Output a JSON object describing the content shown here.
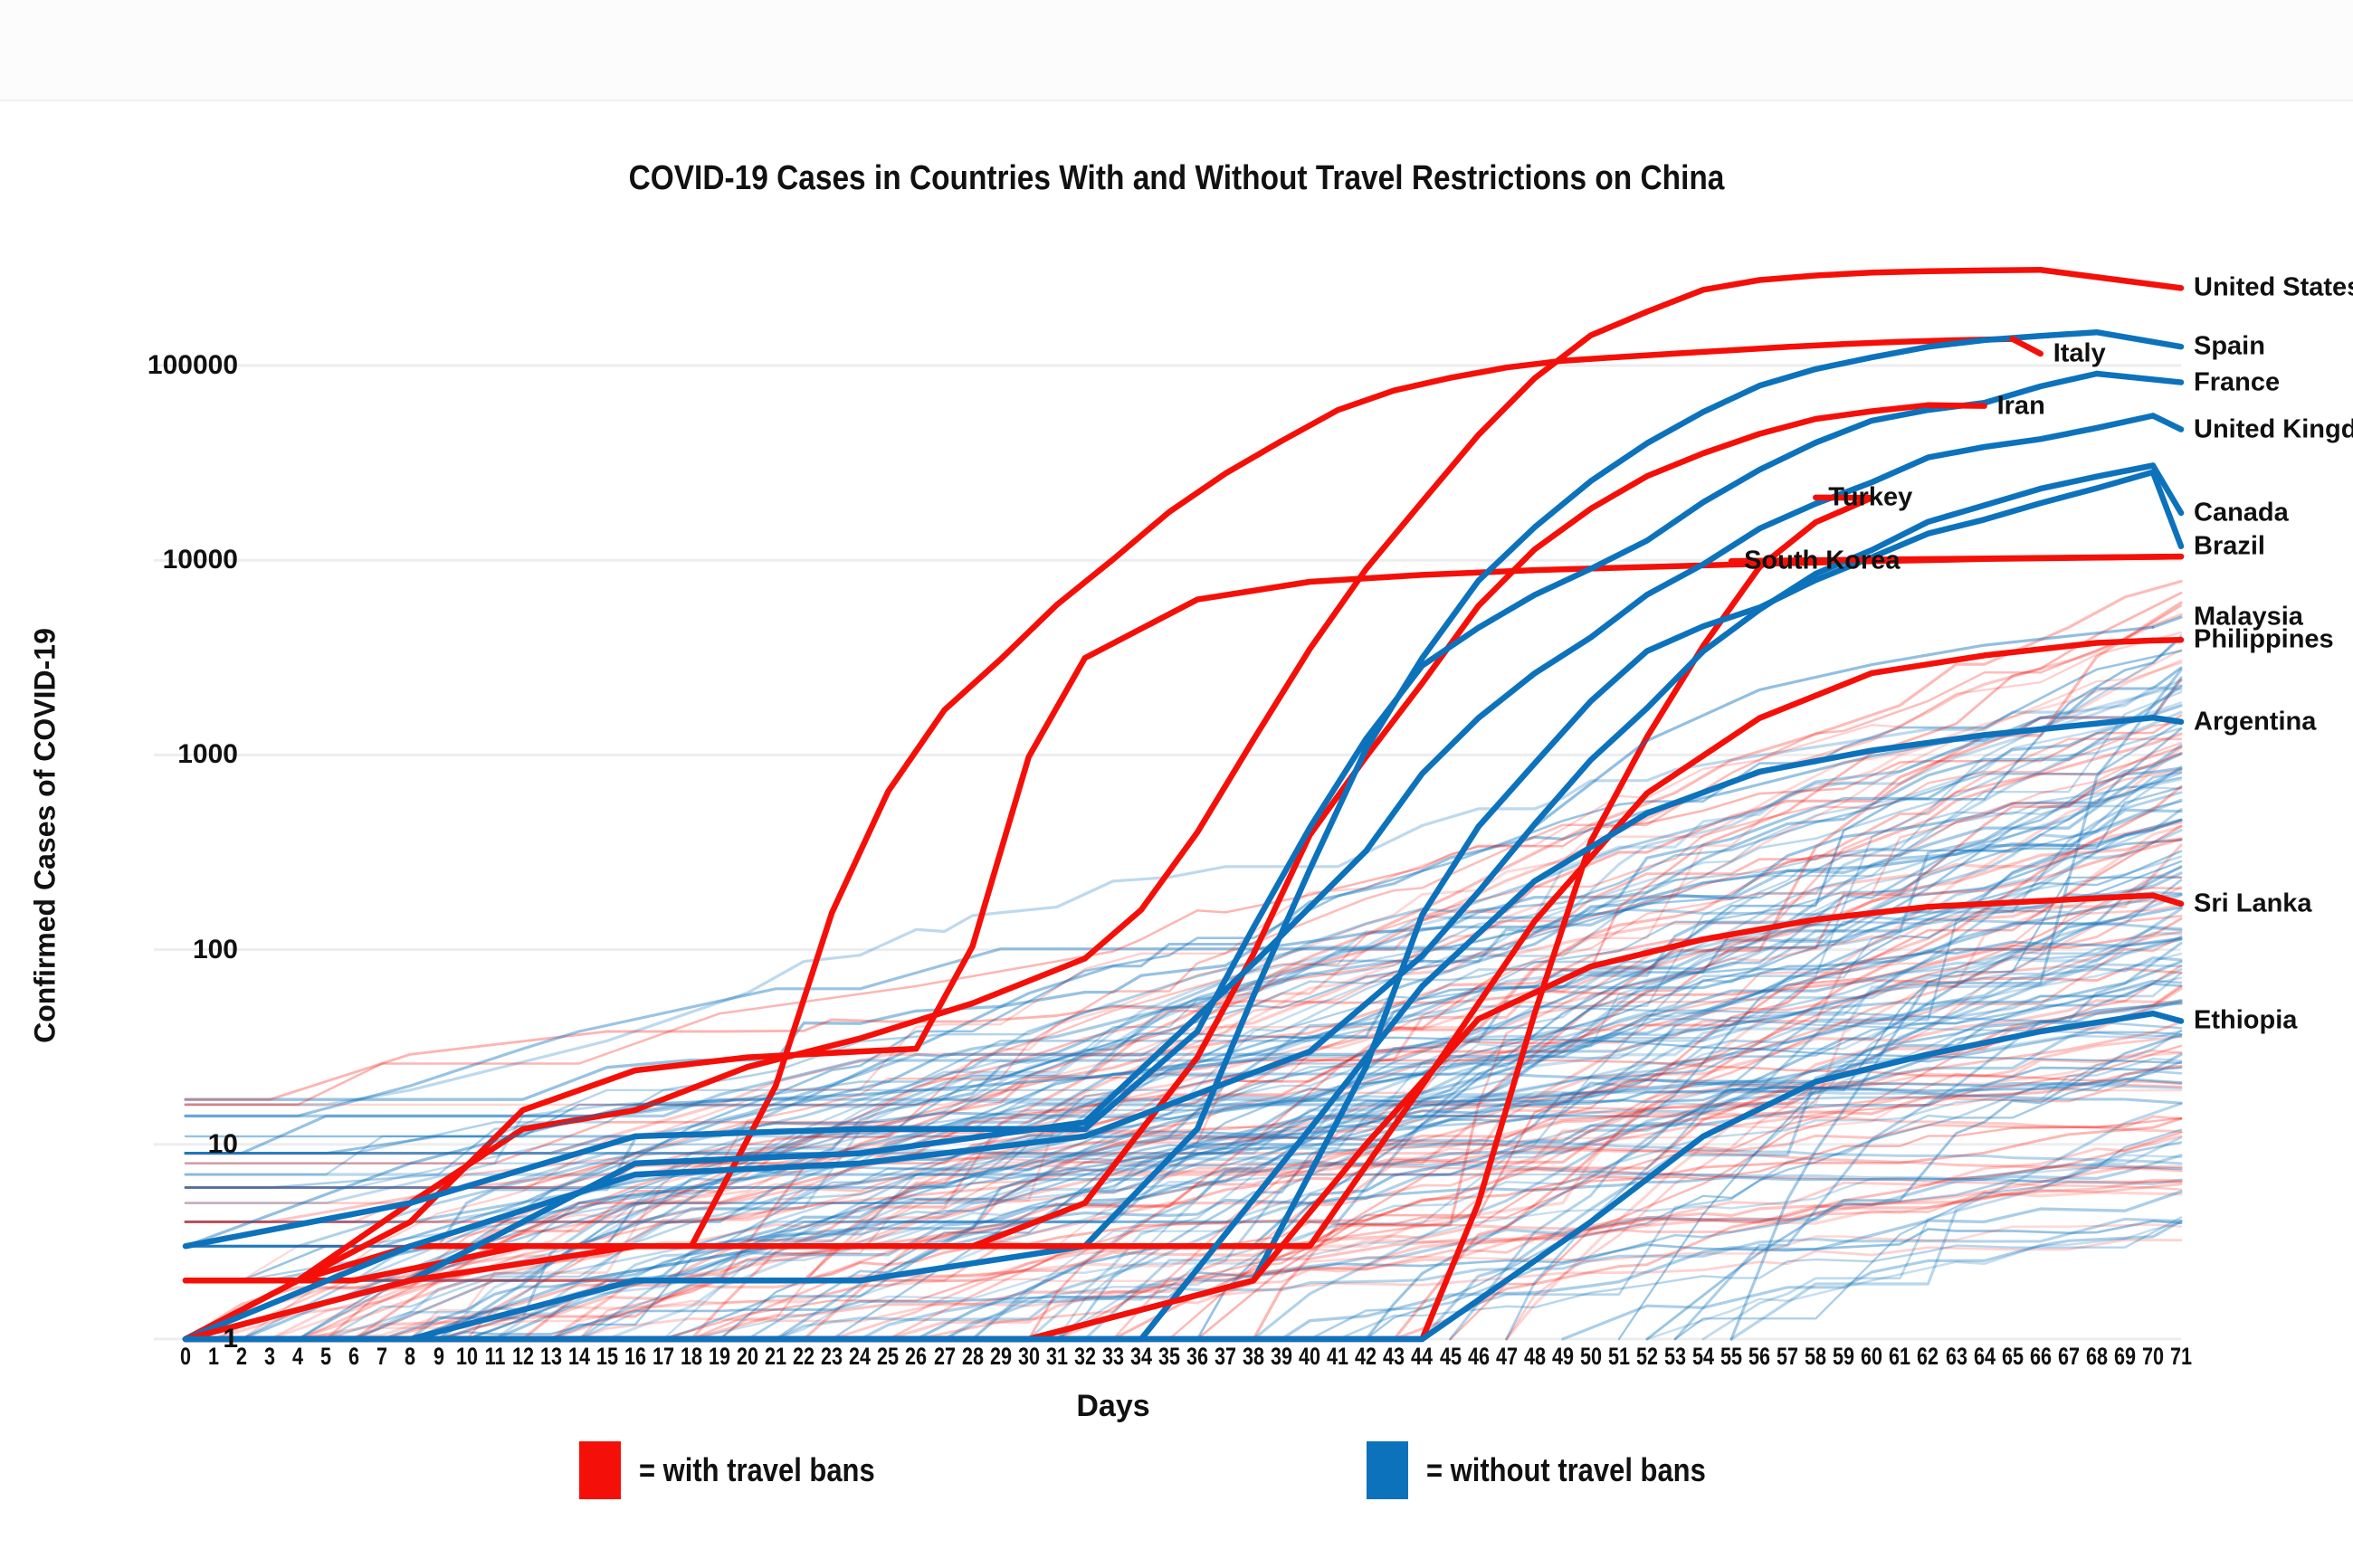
{
  "chart_data": {
    "type": "line",
    "title": "COVID-19 Cases in Countries With and Without Travel Restrictions on China",
    "xlabel": "Days",
    "ylabel": "Confirmed Cases of COVID-19",
    "yscale": "log",
    "ylim": [
      1,
      300000
    ],
    "yticks": [
      "1",
      "10",
      "100",
      "1000",
      "10000",
      "100000"
    ],
    "ytick_values": [
      1,
      10,
      100,
      1000,
      10000,
      100000
    ],
    "xlim": [
      0,
      71
    ],
    "grid": "horizontal-only",
    "xticks": [
      "0",
      "1",
      "2",
      "3",
      "4",
      "5",
      "6",
      "7",
      "8",
      "9",
      "10",
      "11",
      "12",
      "13",
      "14",
      "15",
      "16",
      "17",
      "18",
      "19",
      "20",
      "21",
      "22",
      "23",
      "24",
      "25",
      "26",
      "27",
      "28",
      "29",
      "30",
      "31",
      "32",
      "33",
      "34",
      "35",
      "36",
      "37",
      "38",
      "39",
      "40",
      "41",
      "42",
      "43",
      "44",
      "45",
      "46",
      "47",
      "48",
      "49",
      "50",
      "51",
      "52",
      "53",
      "54",
      "55",
      "56",
      "57",
      "58",
      "59",
      "60",
      "61",
      "62",
      "63",
      "64",
      "65",
      "66",
      "67",
      "68",
      "69",
      "70",
      "71"
    ],
    "legend": {
      "position": "bottom",
      "entries": [
        {
          "label": "= with travel bans",
          "color": "#F41008",
          "group": "with"
        },
        {
          "label": "= without travel bans",
          "color": "#0D72BC",
          "group": "without"
        }
      ]
    },
    "colors": {
      "with_travel_bans": "#F41008",
      "without_travel_bans": "#0D72BC",
      "with_travel_bans_faded": "#F4100840",
      "without_travel_bans_faded": "#0D72BC40",
      "gridline": "#ededf0",
      "text": "#111111",
      "background": "#ffffff"
    },
    "series": [
      {
        "name": "United States",
        "group": "with",
        "color": "#F41008",
        "highlight": true,
        "label_x": 71,
        "label_y": 250000,
        "x": [
          0,
          4,
          8,
          12,
          16,
          20,
          24,
          28,
          32,
          34,
          36,
          38,
          40,
          42,
          44,
          46,
          48,
          50,
          52,
          54,
          56,
          58,
          60,
          62,
          64,
          66
        ],
        "values": [
          1,
          2,
          5,
          12,
          15,
          25,
          35,
          53,
          90,
          160,
          400,
          1200,
          3500,
          9000,
          20000,
          44000,
          86000,
          143000,
          189000,
          245000,
          275000,
          290000,
          300000,
          305000,
          308000,
          310000
        ]
      },
      {
        "name": "Italy",
        "group": "with",
        "color": "#F41008",
        "highlight": true,
        "label_x": 66,
        "label_y": 115000,
        "x": [
          0,
          6,
          12,
          18,
          21,
          23,
          25,
          27,
          29,
          31,
          33,
          35,
          37,
          39,
          41,
          43,
          45,
          47,
          49,
          51,
          53,
          55,
          57,
          59,
          61,
          63,
          65
        ],
        "values": [
          2,
          2,
          3,
          3,
          20,
          155,
          650,
          1700,
          3100,
          5900,
          10100,
          17700,
          27900,
          41000,
          59100,
          74400,
          86500,
          97700,
          105800,
          110600,
          115200,
          119800,
          124600,
          128900,
          132500,
          135000,
          137000
        ]
      },
      {
        "name": "Iran",
        "group": "with",
        "color": "#F41008",
        "highlight": true,
        "label_x": 64,
        "label_y": 62000,
        "x": [
          0,
          4,
          8,
          12,
          16,
          20,
          24,
          28,
          32,
          36,
          38,
          40,
          42,
          44,
          46,
          48,
          50,
          52,
          54,
          56,
          58,
          60,
          62
        ],
        "values": [
          2,
          2,
          3,
          3,
          3,
          3,
          3,
          3,
          5,
          28,
          95,
          388,
          978,
          2336,
          5823,
          11364,
          18407,
          27017,
          35408,
          44605,
          53183,
          58226,
          62589
        ]
      },
      {
        "name": "Turkey",
        "group": "with",
        "color": "#F41008",
        "highlight": true,
        "label_x": 58,
        "label_y": 21000,
        "x": [
          0,
          8,
          16,
          24,
          32,
          40,
          44,
          46,
          48,
          50,
          52,
          54,
          56,
          58,
          60
        ],
        "values": [
          1,
          1,
          1,
          1,
          1,
          1,
          1,
          5,
          47,
          359,
          1236,
          3629,
          9217,
          15679,
          20921
        ]
      },
      {
        "name": "South Korea",
        "group": "with",
        "color": "#F41008",
        "highlight": true,
        "label_x": 55,
        "label_y": 9900,
        "x": [
          0,
          4,
          8,
          12,
          16,
          20,
          24,
          26,
          28,
          30,
          32,
          36,
          40,
          44,
          48,
          52,
          56,
          60,
          64,
          68,
          71
        ],
        "values": [
          1,
          2,
          4,
          15,
          24,
          28,
          30,
          31,
          104,
          977,
          3150,
          6284,
          7755,
          8413,
          8897,
          9241,
          9583,
          9887,
          10156,
          10331,
          10450
        ]
      },
      {
        "name": "Spain",
        "group": "without",
        "color": "#0D72BC",
        "highlight": true,
        "label_x": 71,
        "label_y": 125000,
        "x": [
          0,
          8,
          16,
          24,
          32,
          36,
          38,
          40,
          42,
          44,
          46,
          48,
          50,
          52,
          54,
          56,
          58,
          60,
          62,
          64,
          66,
          68
        ],
        "values": [
          1,
          1,
          2,
          2,
          3,
          12,
          58,
          258,
          1073,
          3146,
          7845,
          14769,
          25496,
          39885,
          57786,
          78797,
          95923,
          110238,
          124736,
          135032,
          141942,
          148220
        ]
      },
      {
        "name": "France",
        "group": "without",
        "color": "#0D72BC",
        "highlight": true,
        "label_x": 71,
        "label_y": 82000,
        "x": [
          0,
          8,
          16,
          24,
          32,
          36,
          38,
          40,
          42,
          44,
          46,
          48,
          50,
          52,
          54,
          56,
          58,
          60,
          62,
          64,
          66,
          68
        ],
        "values": [
          3,
          5,
          11,
          12,
          12,
          38,
          130,
          423,
          1209,
          2876,
          4499,
          6633,
          9043,
          12612,
          19856,
          29155,
          40174,
          52128,
          59105,
          64338,
          78167,
          90848
        ]
      },
      {
        "name": "United Kingdom",
        "group": "without",
        "color": "#0D72BC",
        "highlight": true,
        "label_x": 71,
        "label_y": 47000,
        "x": [
          0,
          8,
          16,
          24,
          32,
          38,
          42,
          44,
          46,
          48,
          50,
          52,
          54,
          56,
          58,
          60,
          62,
          64,
          66,
          68,
          70
        ],
        "values": [
          1,
          2,
          8,
          9,
          13,
          85,
          321,
          802,
          1547,
          2626,
          4014,
          6650,
          9529,
          14543,
          19522,
          25150,
          33718,
          38168,
          41903,
          47806,
          55242
        ]
      },
      {
        "name": "Canada",
        "group": "without",
        "color": "#0D72BC",
        "highlight": true,
        "label_x": 71,
        "label_y": 17500,
        "x": [
          0,
          8,
          16,
          24,
          32,
          40,
          44,
          46,
          48,
          50,
          52,
          54,
          56,
          58,
          60,
          62,
          64,
          66,
          68,
          70
        ],
        "values": [
          1,
          3,
          7,
          8,
          11,
          30,
          93,
          198,
          441,
          943,
          1739,
          3409,
          5576,
          8527,
          11284,
          15756,
          19141,
          23316,
          26897,
          30659
        ]
      },
      {
        "name": "Brazil",
        "group": "without",
        "color": "#0D72BC",
        "highlight": true,
        "label_x": 71,
        "label_y": 11800,
        "x": [
          0,
          10,
          20,
          30,
          38,
          42,
          44,
          46,
          48,
          50,
          52,
          54,
          56,
          58,
          60,
          62,
          64,
          66,
          68,
          70
        ],
        "values": [
          1,
          1,
          1,
          1,
          2,
          25,
          151,
          428,
          904,
          1891,
          3417,
          4579,
          5717,
          7910,
          10360,
          13717,
          16170,
          19638,
          23430,
          28320
        ]
      },
      {
        "name": "Malaysia",
        "group": "without",
        "color": "#0D72BC",
        "highlight": false,
        "label_x": 71,
        "label_y": 5100,
        "x": [
          0,
          8,
          16,
          24,
          32,
          40,
          44,
          48,
          52,
          56,
          60,
          64,
          68,
          70
        ],
        "values": [
          3,
          8,
          16,
          18,
          22,
          29,
          93,
          428,
          1183,
          2161,
          2908,
          3662,
          4228,
          4530
        ]
      },
      {
        "name": "Philippines",
        "group": "with",
        "color": "#F41008",
        "highlight": true,
        "label_x": 71,
        "label_y": 3900,
        "x": [
          0,
          8,
          16,
          24,
          32,
          40,
          44,
          48,
          52,
          56,
          60,
          64,
          68,
          70
        ],
        "values": [
          1,
          2,
          3,
          3,
          3,
          3,
          20,
          140,
          636,
          1546,
          2633,
          3246,
          3764,
          3870
        ]
      },
      {
        "name": "Argentina",
        "group": "without",
        "color": "#0D72BC",
        "highlight": true,
        "label_x": 71,
        "label_y": 1480,
        "x": [
          0,
          20,
          34,
          40,
          44,
          48,
          52,
          56,
          60,
          64,
          68,
          70
        ],
        "values": [
          1,
          1,
          1,
          12,
          65,
          225,
          502,
          820,
          1054,
          1265,
          1451,
          1554
        ]
      },
      {
        "name": "Sri Lanka",
        "group": "with",
        "color": "#F41008",
        "highlight": true,
        "label_x": 71,
        "label_y": 172,
        "x": [
          0,
          16,
          30,
          38,
          42,
          46,
          50,
          54,
          58,
          62,
          66,
          70
        ],
        "values": [
          1,
          1,
          1,
          2,
          10,
          44,
          82,
          113,
          143,
          166,
          178,
          190
        ]
      },
      {
        "name": "Ethiopia",
        "group": "without",
        "color": "#0D72BC",
        "highlight": true,
        "label_x": 71,
        "label_y": 43,
        "x": [
          0,
          44,
          50,
          54,
          58,
          62,
          66,
          70
        ],
        "values": [
          1,
          1,
          4,
          11,
          21,
          29,
          38,
          47
        ]
      }
    ],
    "background_series_note": "Approximately 160 additional faded country trajectories drawn in pale red (with travel bans) and pale blue (without travel bans) behind the highlighted lines."
  },
  "axes": {
    "y_title": "Confirmed Cases of COVID-19",
    "x_title": "Days"
  }
}
